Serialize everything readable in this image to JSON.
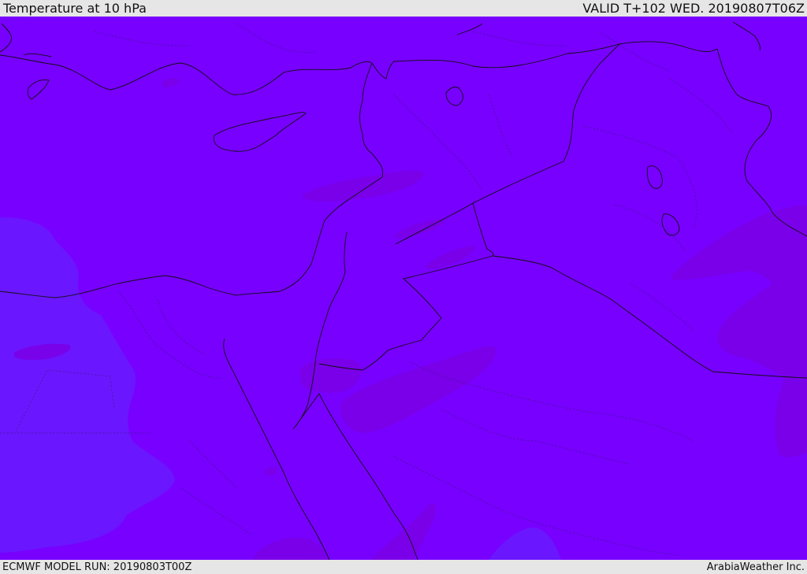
{
  "header": {
    "title": "Temperature at 10 hPa",
    "valid_time": "VALID T+102 WED. 20190807T06Z"
  },
  "footer": {
    "model_run": "ECMWF MODEL RUN: 20190803T00Z",
    "credit": "ArabiaWeather Inc."
  },
  "map": {
    "field": "Temperature at 10 hPa",
    "colors": {
      "base": "#7800ff",
      "cooler_patch": "#6a14ff",
      "warmer_patch": "#7a00e6",
      "border_line": "#111111",
      "province_line": "#3a1a7a"
    }
  }
}
